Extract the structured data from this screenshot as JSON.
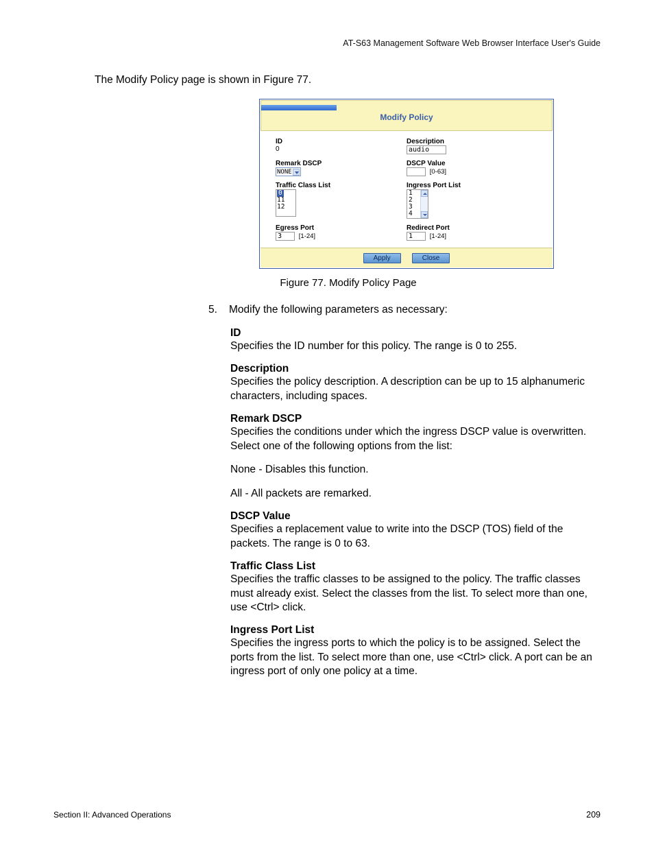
{
  "header": {
    "doc_title": "AT-S63 Management Software Web Browser Interface User's Guide"
  },
  "intro": "The Modify Policy page is shown in Figure 77.",
  "figure": {
    "title": "Modify Policy",
    "id_label": "ID",
    "id_value": "0",
    "desc_label": "Description",
    "desc_value": "audio",
    "remark_label": "Remark DSCP",
    "remark_value": "NONE",
    "dscp_label": "DSCP Value",
    "dscp_value": "",
    "dscp_range": "[0-63]",
    "tcl_label": "Traffic Class List",
    "tcl_items": [
      "0",
      "11",
      "12"
    ],
    "ipl_label": "Ingress Port List",
    "ipl_items": [
      "1",
      "2",
      "3",
      "4"
    ],
    "egress_label": "Egress Port",
    "egress_value": "3",
    "egress_range": "[1-24]",
    "redirect_label": "Redirect Port",
    "redirect_value": "1",
    "redirect_range": "[1-24]",
    "apply": "Apply",
    "close": "Close",
    "caption": "Figure 77. Modify Policy Page"
  },
  "step": {
    "num": "5.",
    "text": "Modify the following parameters as necessary:"
  },
  "defs": {
    "id": {
      "term": "ID",
      "desc": "Specifies the ID number for this policy. The range is 0 to 255."
    },
    "desc": {
      "term": "Description",
      "desc": "Specifies the policy description. A description can be up to 15 alphanumeric characters, including spaces."
    },
    "remark": {
      "term": "Remark DSCP",
      "desc": "Specifies the conditions under which the ingress DSCP value is overwritten. Select one of the following options from the list:",
      "opt1": "None - Disables this function.",
      "opt2": "All - All packets are remarked."
    },
    "dscp": {
      "term": "DSCP Value",
      "desc": "Specifies a replacement value to write into the DSCP (TOS) field of the packets. The range is 0 to 63."
    },
    "tcl": {
      "term": "Traffic Class List",
      "desc": "Specifies the traffic classes to be assigned to the policy. The traffic classes must already exist. Select the classes from the list. To select more than one, use <Ctrl> click."
    },
    "ipl": {
      "term": "Ingress Port List",
      "desc": "Specifies the ingress ports to which the policy is to be assigned. Select the ports from the list. To select more than one, use <Ctrl> click. A port can be an ingress port of only one policy at a time."
    }
  },
  "footer": {
    "section": "Section II: Advanced Operations",
    "page": "209"
  }
}
